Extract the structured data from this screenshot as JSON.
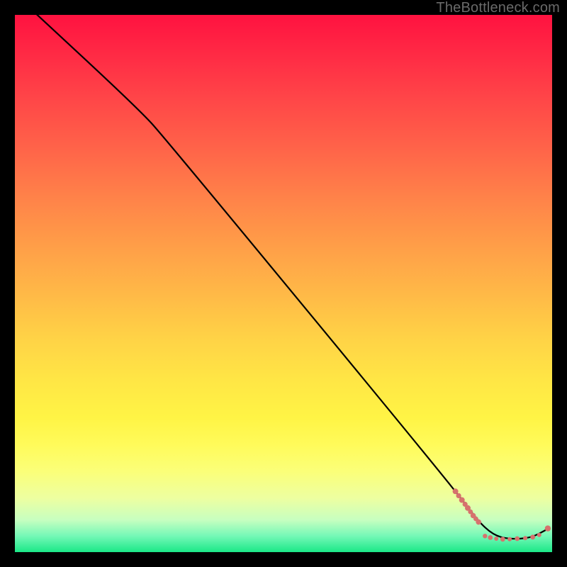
{
  "watermark": "TheBottleneck.com",
  "colors": {
    "curve": "#000000",
    "point_fill": "#d6726d",
    "gradient_top": "#ff1240",
    "gradient_bottom": "#1be887",
    "frame_background": "#000000"
  },
  "chart_data": {
    "type": "line",
    "title": "",
    "xlabel": "",
    "ylabel": "",
    "xlim": [
      0,
      100
    ],
    "ylim": [
      0,
      100
    ],
    "grid": false,
    "curve": [
      {
        "x": 2.0,
        "y": 102.0
      },
      {
        "x": 23.0,
        "y": 82.5
      },
      {
        "x": 28.0,
        "y": 77.0
      },
      {
        "x": 82.0,
        "y": 11.5
      },
      {
        "x": 86.0,
        "y": 6.0
      },
      {
        "x": 89.0,
        "y": 3.2
      },
      {
        "x": 92.0,
        "y": 2.4
      },
      {
        "x": 96.0,
        "y": 2.6
      },
      {
        "x": 99.0,
        "y": 4.2
      }
    ],
    "points": [
      {
        "x": 82.0,
        "y": 11.3,
        "r": 4.0
      },
      {
        "x": 82.6,
        "y": 10.5,
        "r": 3.6
      },
      {
        "x": 83.2,
        "y": 9.7,
        "r": 4.0
      },
      {
        "x": 83.8,
        "y": 8.9,
        "r": 3.6
      },
      {
        "x": 84.3,
        "y": 8.2,
        "r": 4.0
      },
      {
        "x": 84.8,
        "y": 7.5,
        "r": 3.4
      },
      {
        "x": 85.3,
        "y": 6.8,
        "r": 3.8
      },
      {
        "x": 85.8,
        "y": 6.2,
        "r": 3.4
      },
      {
        "x": 86.3,
        "y": 5.6,
        "r": 3.8
      },
      {
        "x": 87.5,
        "y": 3.0,
        "r": 3.2
      },
      {
        "x": 88.5,
        "y": 2.7,
        "r": 3.4
      },
      {
        "x": 89.6,
        "y": 2.5,
        "r": 3.0
      },
      {
        "x": 90.8,
        "y": 2.4,
        "r": 3.4
      },
      {
        "x": 92.1,
        "y": 2.4,
        "r": 3.0
      },
      {
        "x": 93.5,
        "y": 2.5,
        "r": 3.4
      },
      {
        "x": 95.0,
        "y": 2.6,
        "r": 3.0
      },
      {
        "x": 96.4,
        "y": 2.8,
        "r": 3.4
      },
      {
        "x": 97.6,
        "y": 3.2,
        "r": 3.0
      },
      {
        "x": 99.2,
        "y": 4.4,
        "r": 4.2
      }
    ]
  }
}
